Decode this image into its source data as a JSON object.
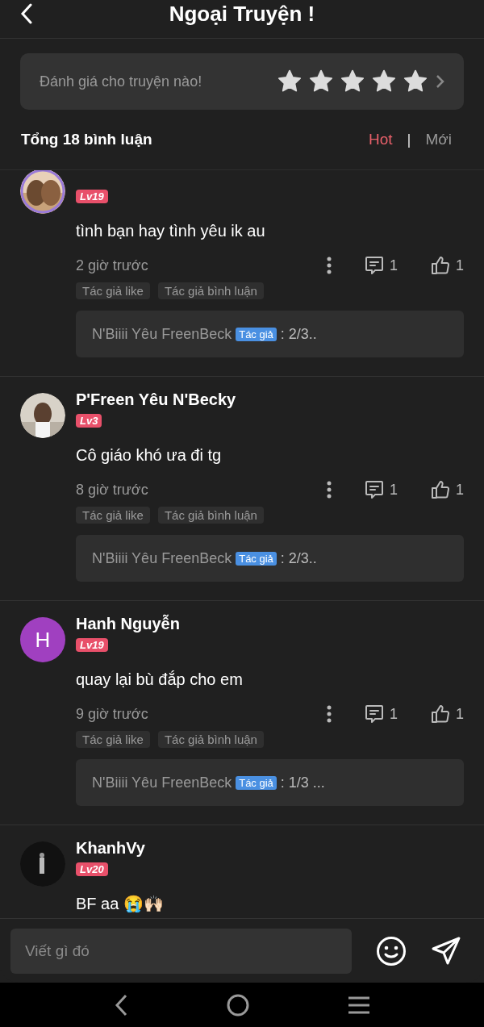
{
  "header": {
    "title": "Ngoại Truyện !"
  },
  "rating": {
    "prompt": "Đánh giá cho truyện nào!",
    "stars": 5
  },
  "comments_header": {
    "total": "Tổng 18 bình luận",
    "sort_tabs": [
      {
        "label": "Hot",
        "selected": true
      },
      {
        "label": "|",
        "kind": "separator"
      },
      {
        "label": "Mới",
        "selected": false
      }
    ]
  },
  "comments": [
    {
      "avatar": {
        "kind": "picture"
      },
      "level": "Lv19",
      "text": "tình bạn hay tình yêu ik au",
      "time": "2 giờ trước",
      "reply_count": "1",
      "like_count": "1",
      "tags": [
        "Tác giả like",
        "Tác giả bình luận"
      ],
      "reply": {
        "author": "N'Biiii Yêu FreenBeck",
        "badge": "Tác giả",
        "text": ": 2/3.."
      }
    },
    {
      "avatar": {
        "kind": "picture"
      },
      "name": "P'Freen Yêu N'Becky",
      "level": "Lv3",
      "text": "Cô giáo khó ưa đi tg",
      "time": "8 giờ trước",
      "reply_count": "1",
      "like_count": "1",
      "tags": [
        "Tác giả like",
        "Tác giả bình luận"
      ],
      "reply": {
        "author": "N'Biiii Yêu FreenBeck",
        "badge": "Tác giả",
        "text": ": 2/3.."
      }
    },
    {
      "avatar": {
        "kind": "letter",
        "letter": "H",
        "color": "#a040c0"
      },
      "name": "Hanh Nguyễn",
      "level": "Lv19",
      "text": "quay lại bù đắp cho em",
      "time": "9 giờ trước",
      "reply_count": "1",
      "like_count": "1",
      "tags": [
        "Tác giả like",
        "Tác giả bình luận"
      ],
      "reply": {
        "author": "N'Biiii Yêu FreenBeck",
        "badge": "Tác giả",
        "text": ": 1/3 ..."
      }
    },
    {
      "avatar": {
        "kind": "picture"
      },
      "name": "KhanhVy",
      "level": "Lv20",
      "text": "BF aa 😭🙌🏻"
    }
  ],
  "composer": {
    "placeholder": "Viết gì đó"
  }
}
